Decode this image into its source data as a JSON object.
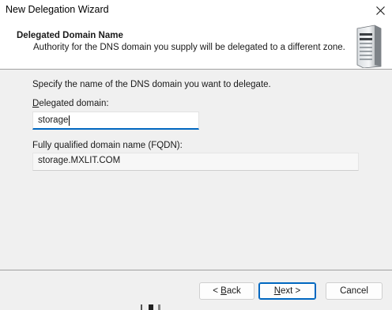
{
  "window": {
    "title": "New Delegation Wizard"
  },
  "header": {
    "title": "Delegated Domain Name",
    "subtitle": "Authority for the DNS domain you supply will be delegated to a different zone."
  },
  "form": {
    "prompt": "Specify the name of the DNS domain you want to delegate.",
    "domain_label_mnemonic": "D",
    "domain_label_rest": "elegated domain:",
    "domain_value": "storage",
    "fqdn_label": "Fully qualified domain name (FQDN):",
    "fqdn_value": "storage.MXLIT.COM"
  },
  "buttons": {
    "back_prefix": "< ",
    "back_mnemonic": "B",
    "back_rest": "ack",
    "next_mnemonic": "N",
    "next_rest": "ext >",
    "cancel": "Cancel"
  },
  "icons": {
    "close": "close-icon",
    "server": "server-icon"
  },
  "colors": {
    "accent": "#0067c0",
    "header_bg": "#ffffff",
    "dialog_bg": "#f0f0f0"
  }
}
